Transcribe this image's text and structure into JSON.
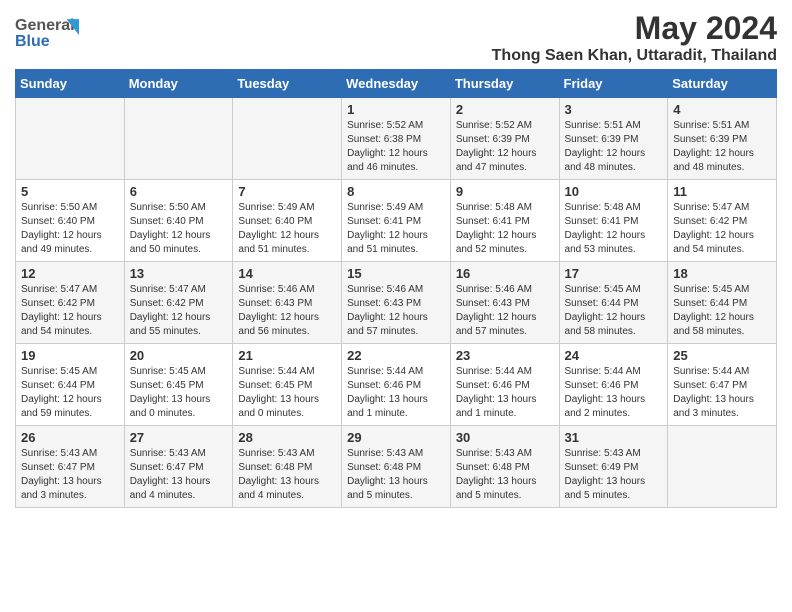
{
  "logo": {
    "line1": "General",
    "line2": "Blue"
  },
  "title": "May 2024",
  "subtitle": "Thong Saen Khan, Uttaradit, Thailand",
  "days_of_week": [
    "Sunday",
    "Monday",
    "Tuesday",
    "Wednesday",
    "Thursday",
    "Friday",
    "Saturday"
  ],
  "weeks": [
    [
      {
        "day": "",
        "info": ""
      },
      {
        "day": "",
        "info": ""
      },
      {
        "day": "",
        "info": ""
      },
      {
        "day": "1",
        "info": "Sunrise: 5:52 AM\nSunset: 6:38 PM\nDaylight: 12 hours\nand 46 minutes."
      },
      {
        "day": "2",
        "info": "Sunrise: 5:52 AM\nSunset: 6:39 PM\nDaylight: 12 hours\nand 47 minutes."
      },
      {
        "day": "3",
        "info": "Sunrise: 5:51 AM\nSunset: 6:39 PM\nDaylight: 12 hours\nand 48 minutes."
      },
      {
        "day": "4",
        "info": "Sunrise: 5:51 AM\nSunset: 6:39 PM\nDaylight: 12 hours\nand 48 minutes."
      }
    ],
    [
      {
        "day": "5",
        "info": "Sunrise: 5:50 AM\nSunset: 6:40 PM\nDaylight: 12 hours\nand 49 minutes."
      },
      {
        "day": "6",
        "info": "Sunrise: 5:50 AM\nSunset: 6:40 PM\nDaylight: 12 hours\nand 50 minutes."
      },
      {
        "day": "7",
        "info": "Sunrise: 5:49 AM\nSunset: 6:40 PM\nDaylight: 12 hours\nand 51 minutes."
      },
      {
        "day": "8",
        "info": "Sunrise: 5:49 AM\nSunset: 6:41 PM\nDaylight: 12 hours\nand 51 minutes."
      },
      {
        "day": "9",
        "info": "Sunrise: 5:48 AM\nSunset: 6:41 PM\nDaylight: 12 hours\nand 52 minutes."
      },
      {
        "day": "10",
        "info": "Sunrise: 5:48 AM\nSunset: 6:41 PM\nDaylight: 12 hours\nand 53 minutes."
      },
      {
        "day": "11",
        "info": "Sunrise: 5:47 AM\nSunset: 6:42 PM\nDaylight: 12 hours\nand 54 minutes."
      }
    ],
    [
      {
        "day": "12",
        "info": "Sunrise: 5:47 AM\nSunset: 6:42 PM\nDaylight: 12 hours\nand 54 minutes."
      },
      {
        "day": "13",
        "info": "Sunrise: 5:47 AM\nSunset: 6:42 PM\nDaylight: 12 hours\nand 55 minutes."
      },
      {
        "day": "14",
        "info": "Sunrise: 5:46 AM\nSunset: 6:43 PM\nDaylight: 12 hours\nand 56 minutes."
      },
      {
        "day": "15",
        "info": "Sunrise: 5:46 AM\nSunset: 6:43 PM\nDaylight: 12 hours\nand 57 minutes."
      },
      {
        "day": "16",
        "info": "Sunrise: 5:46 AM\nSunset: 6:43 PM\nDaylight: 12 hours\nand 57 minutes."
      },
      {
        "day": "17",
        "info": "Sunrise: 5:45 AM\nSunset: 6:44 PM\nDaylight: 12 hours\nand 58 minutes."
      },
      {
        "day": "18",
        "info": "Sunrise: 5:45 AM\nSunset: 6:44 PM\nDaylight: 12 hours\nand 58 minutes."
      }
    ],
    [
      {
        "day": "19",
        "info": "Sunrise: 5:45 AM\nSunset: 6:44 PM\nDaylight: 12 hours\nand 59 minutes."
      },
      {
        "day": "20",
        "info": "Sunrise: 5:45 AM\nSunset: 6:45 PM\nDaylight: 13 hours\nand 0 minutes."
      },
      {
        "day": "21",
        "info": "Sunrise: 5:44 AM\nSunset: 6:45 PM\nDaylight: 13 hours\nand 0 minutes."
      },
      {
        "day": "22",
        "info": "Sunrise: 5:44 AM\nSunset: 6:46 PM\nDaylight: 13 hours\nand 1 minute."
      },
      {
        "day": "23",
        "info": "Sunrise: 5:44 AM\nSunset: 6:46 PM\nDaylight: 13 hours\nand 1 minute."
      },
      {
        "day": "24",
        "info": "Sunrise: 5:44 AM\nSunset: 6:46 PM\nDaylight: 13 hours\nand 2 minutes."
      },
      {
        "day": "25",
        "info": "Sunrise: 5:44 AM\nSunset: 6:47 PM\nDaylight: 13 hours\nand 3 minutes."
      }
    ],
    [
      {
        "day": "26",
        "info": "Sunrise: 5:43 AM\nSunset: 6:47 PM\nDaylight: 13 hours\nand 3 minutes."
      },
      {
        "day": "27",
        "info": "Sunrise: 5:43 AM\nSunset: 6:47 PM\nDaylight: 13 hours\nand 4 minutes."
      },
      {
        "day": "28",
        "info": "Sunrise: 5:43 AM\nSunset: 6:48 PM\nDaylight: 13 hours\nand 4 minutes."
      },
      {
        "day": "29",
        "info": "Sunrise: 5:43 AM\nSunset: 6:48 PM\nDaylight: 13 hours\nand 5 minutes."
      },
      {
        "day": "30",
        "info": "Sunrise: 5:43 AM\nSunset: 6:48 PM\nDaylight: 13 hours\nand 5 minutes."
      },
      {
        "day": "31",
        "info": "Sunrise: 5:43 AM\nSunset: 6:49 PM\nDaylight: 13 hours\nand 5 minutes."
      },
      {
        "day": "",
        "info": ""
      }
    ]
  ],
  "colors": {
    "header_bg": "#2e6db4",
    "header_text": "#ffffff",
    "odd_row": "#f5f5f5",
    "even_row": "#ffffff"
  }
}
